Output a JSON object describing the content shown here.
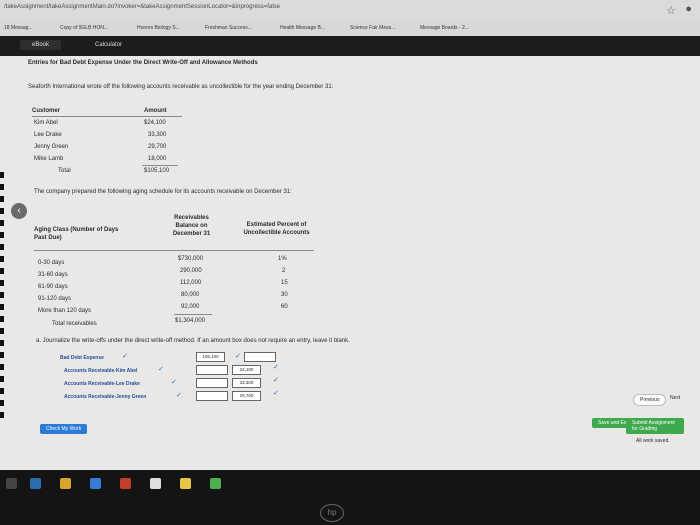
{
  "browser": {
    "address": "/takeAssignment/takeAssignmentMain.do?invoker=&takeAssignmentSessionLocator=&inprogress=false",
    "bookmarks": [
      "18 Messag...",
      "Copy of 9GLB HON...",
      "Honors Biology S...",
      "Freshman Success...",
      "Health Message B...",
      "Science Fair Mess...",
      "Message Boards - 2..."
    ],
    "tabs": [
      "eBook",
      "Calculator"
    ]
  },
  "problem": {
    "heading": "Entries for Bad Debt Expense Under the Direct Write-Off and Allowance Methods",
    "intro": "Seaforth International wrote off the following accounts receivable as uncollectible for the year ending December 31:",
    "customers_header": [
      "Customer",
      "Amount"
    ],
    "customers": [
      {
        "name": "Kim Abel",
        "amount": "$24,100"
      },
      {
        "name": "Lee Drake",
        "amount": "33,300"
      },
      {
        "name": "Jenny Green",
        "amount": "29,700"
      },
      {
        "name": "Mike Lamb",
        "amount": "18,000"
      }
    ],
    "total_label": "Total",
    "total_amount": "$105,100",
    "aging_intro": "The company prepared the following aging schedule for its accounts receivable on December 31:",
    "aging_header": {
      "class": "Aging Class (Number of Days Past Due)",
      "balance": "Receivables Balance on December 31",
      "percent": "Estimated Percent of Uncollectible Accounts"
    },
    "aging": [
      {
        "class": "0-30 days",
        "balance": "$730,000",
        "percent": "1%"
      },
      {
        "class": "31-60 days",
        "balance": "290,000",
        "percent": "2"
      },
      {
        "class": "61-90 days",
        "balance": "112,000",
        "percent": "15"
      },
      {
        "class": "91-120 days",
        "balance": "80,000",
        "percent": "30"
      },
      {
        "class": "More than 120 days",
        "balance": "92,000",
        "percent": "60"
      }
    ],
    "aging_total_label": "Total receivables",
    "aging_total": "$1,304,000",
    "part_a": "a. Journalize the write-offs under the direct write-off method. If an amount box does not require an entry, leave it blank.",
    "journal": [
      {
        "account": "Bad Debt Expense",
        "debit": "105,100",
        "credit": ""
      },
      {
        "account": "Accounts Receivable-Kim Abel",
        "debit": "",
        "credit": "24,100"
      },
      {
        "account": "Accounts Receivable-Lee Drake",
        "debit": "",
        "credit": "33,300"
      },
      {
        "account": "Accounts Receivable-Jenny Green",
        "debit": "",
        "credit": "29,700"
      }
    ],
    "check_button": "Check My Work",
    "previous_button": "Previous",
    "next_button": "Next",
    "save_button": "Save and Exit",
    "submit_button": "Submit Assignment for Grading",
    "saved_text": "All work saved."
  },
  "device": {
    "logo": "hp"
  }
}
